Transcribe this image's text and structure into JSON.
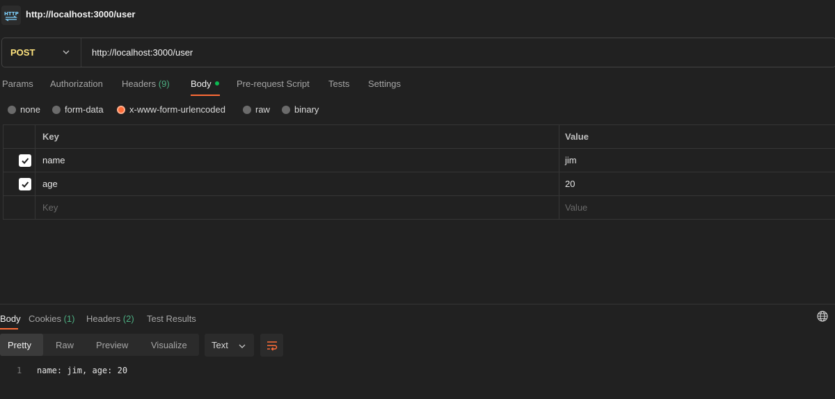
{
  "window": {
    "title": "http://localhost:3000/user",
    "icon": "http-file-icon"
  },
  "request": {
    "method": "POST",
    "url": "http://localhost:3000/user",
    "tabs": [
      {
        "label": "Params"
      },
      {
        "label": "Authorization"
      },
      {
        "label": "Headers",
        "count": "(9)"
      },
      {
        "label": "Body",
        "active": true,
        "indicator": "green-dot"
      },
      {
        "label": "Pre-request Script"
      },
      {
        "label": "Tests"
      },
      {
        "label": "Settings"
      }
    ],
    "body_types": [
      {
        "label": "none"
      },
      {
        "label": "form-data"
      },
      {
        "label": "x-www-form-urlencoded",
        "selected": true
      },
      {
        "label": "raw"
      },
      {
        "label": "binary"
      }
    ],
    "table": {
      "headers": {
        "key": "Key",
        "value": "Value"
      },
      "rows": [
        {
          "key": "name",
          "value": "jim",
          "checked": true
        },
        {
          "key": "age",
          "value": "20",
          "checked": true
        }
      ],
      "placeholder": {
        "key": "Key",
        "value": "Value"
      }
    }
  },
  "response": {
    "tabs": [
      {
        "label": "Body",
        "active": true
      },
      {
        "label": "Cookies",
        "count": "(1)"
      },
      {
        "label": "Headers",
        "count": "(2)"
      },
      {
        "label": "Test Results"
      }
    ],
    "views": [
      "Pretty",
      "Raw",
      "Preview",
      "Visualize"
    ],
    "active_view": "Pretty",
    "format": "Text",
    "lines": [
      {
        "number": "1",
        "text": "name: jim, age: 20"
      }
    ]
  },
  "colors": {
    "accent": "#ff6c37",
    "method": "#ffe47e",
    "count": "#4caf82",
    "background": "#212121"
  }
}
